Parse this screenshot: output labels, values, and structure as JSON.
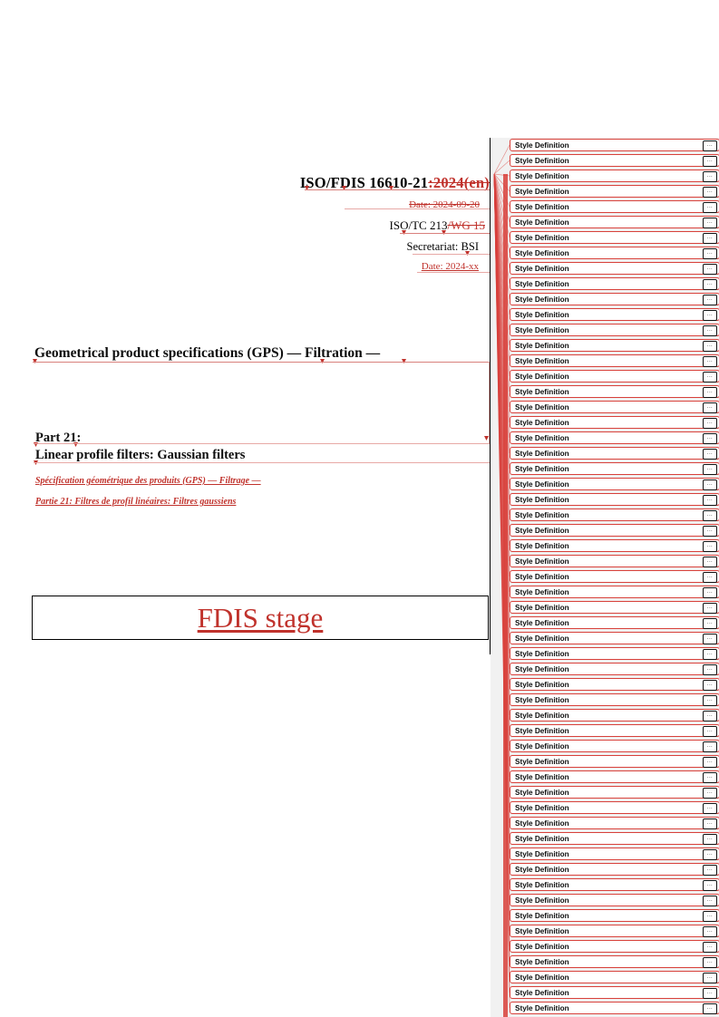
{
  "document": {
    "header": {
      "doc_number_kept": "ISO/FDIS 16610-21",
      "doc_number_deleted": ":2024(en)",
      "date_deleted": "Date: 2024-09-20",
      "committee_kept": "ISO/TC 213",
      "committee_deleted": "/WG 15",
      "secretariat": "Secretariat: BSI",
      "date_inserted": "Date: 2024-xx"
    },
    "titles": {
      "en_main": "Geometrical product specifications (GPS) — Filtration —",
      "part_number": "Part 21:",
      "en_part": "Linear profile filters: Gaussian filters",
      "fr_main": "Spécification géométrique des produits (GPS) — Filtrage —",
      "fr_part": "Partie 21: Filtres de profil linéaires: Filtres gaussiens"
    },
    "stage": {
      "label": "FDIS stage"
    }
  },
  "markup_pane": {
    "comment_label": "Style Definition",
    "ellipsis_label": "...",
    "comment_count": 57,
    "colors": {
      "revision_red": "#c0322c",
      "comment_border": "#d8403a",
      "pane_background": "#f1f1f1",
      "page_rule": "#000000"
    }
  }
}
